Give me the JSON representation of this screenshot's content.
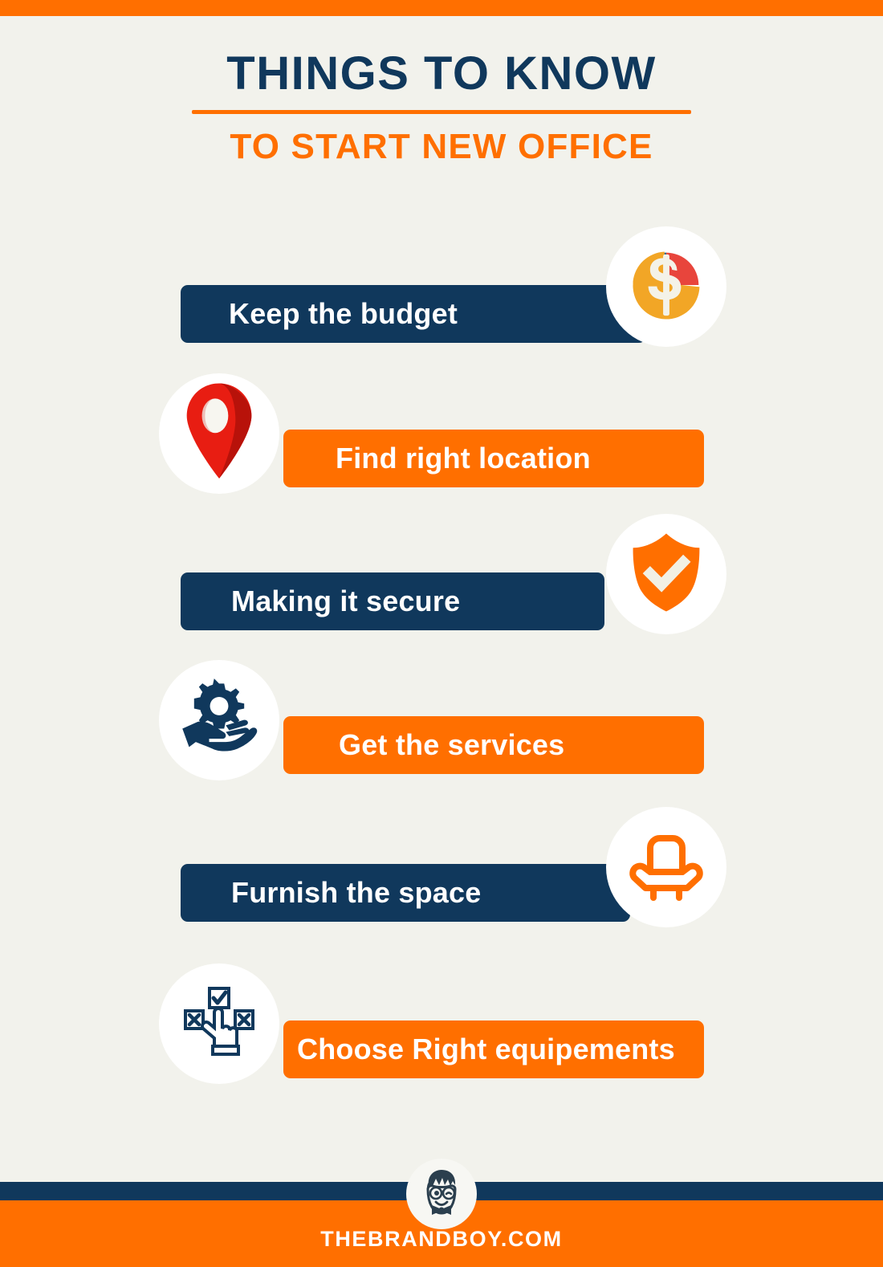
{
  "page": {
    "background_color": "#f2f2ec",
    "accent_orange": "#ff6f00",
    "accent_navy": "#10385c"
  },
  "header": {
    "title": "THINGS TO KNOW",
    "subtitle": "TO START NEW OFFICE"
  },
  "items": [
    {
      "label": "Keep the budget",
      "bar_color": "#10385c",
      "bar_side": "left",
      "icon_side": "right",
      "icon_name": "budget-pie-dollar-icon",
      "icon_colors": {
        "main": "#f2a626",
        "slice_blue": "#2d6489",
        "slice_red": "#e8453c",
        "symbol": "#f3f1e7"
      }
    },
    {
      "label": "Find right location",
      "bar_color": "#ff6f00",
      "bar_side": "right",
      "icon_side": "left",
      "icon_name": "location-pin-icon",
      "icon_colors": {
        "main": "#e81d12",
        "shadow": "#b01109"
      }
    },
    {
      "label": "Making it secure",
      "bar_color": "#10385c",
      "bar_side": "left",
      "icon_side": "right",
      "icon_name": "shield-check-icon",
      "icon_colors": {
        "main": "#ff6f00",
        "symbol": "#f2f0e4"
      }
    },
    {
      "label": "Get the services",
      "bar_color": "#ff6f00",
      "bar_side": "right",
      "icon_side": "left",
      "icon_name": "gear-in-hand-icon",
      "icon_colors": {
        "main": "#10385c"
      }
    },
    {
      "label": "Furnish the space",
      "bar_color": "#10385c",
      "bar_side": "left",
      "icon_side": "right",
      "icon_name": "armchair-icon",
      "icon_colors": {
        "main": "#ff6f00"
      }
    },
    {
      "label": "Choose Right equipements",
      "bar_color": "#ff6f00",
      "bar_side": "right",
      "icon_side": "left",
      "icon_name": "choose-checkbox-hand-icon",
      "icon_colors": {
        "main": "#10385c"
      }
    }
  ],
  "footer": {
    "website": "THEBRANDBOY.COM",
    "logo_name": "brandboy-face-logo"
  }
}
